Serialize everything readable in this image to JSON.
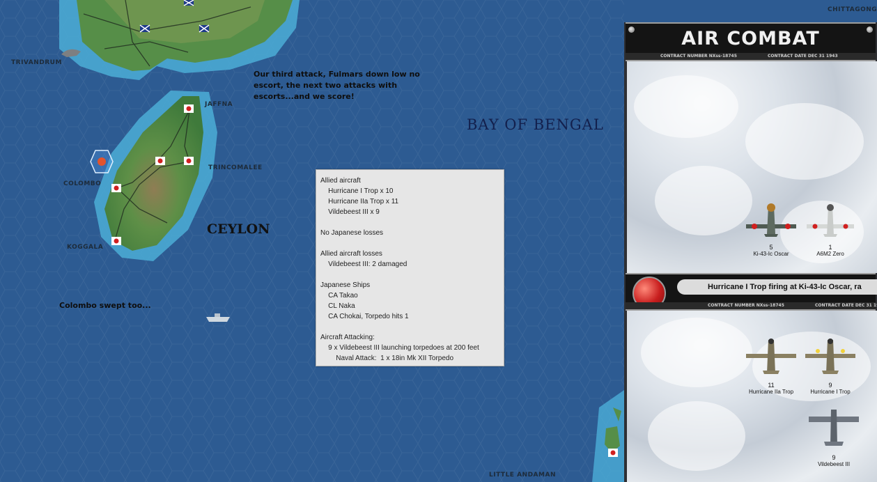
{
  "map": {
    "places": {
      "chittagong": "CHITTAGONG",
      "trivandrum": "TRIVANDRUM",
      "jaffna": "JAFFNA",
      "trincomalee": "TRINCOMALEE",
      "colombo": "COLOMBO",
      "koggala": "KOGGALA",
      "little_andaman": "LITTLE ANDAMAN"
    },
    "regions": {
      "ceylon": "CEYLON",
      "bay_of_bengal": "BAY OF BENGAL"
    },
    "notes": {
      "third_attack": [
        "Our third attack, Fulmars down low no",
        "escort, the next two attacks with",
        "escorts...and we score!"
      ],
      "colombo_swept": "Colombo swept too..."
    },
    "colors": {
      "sea": "#2d5b92",
      "shallow": "#4fb2d6",
      "land": "#4f8a45",
      "coast": "#7aa85c"
    }
  },
  "report": {
    "lines": [
      "Allied aircraft",
      "    Hurricane I Trop x 10",
      "    Hurricane IIa Trop x 11",
      "    Vildebeest III x 9",
      "",
      "No Japanese losses",
      "",
      "Allied aircraft losses",
      "    Vildebeest III: 2 damaged",
      "",
      "Japanese Ships",
      "    CA Takao",
      "    CL Naka",
      "    CA Chokai, Torpedo hits 1",
      "",
      "Aircraft Attacking:",
      "    9 x Vildebeest III launching torpedoes at 200 feet",
      "        Naval Attack:  1 x 18in Mk XII Torpedo"
    ]
  },
  "panel": {
    "title": "AIR COMBAT",
    "contract_number": "CONTRACT NUMBER  NXss-18745",
    "contract_date": "CONTRACT DATE  DEC 31 1943",
    "message": "Hurricane I Trop firing at Ki-43-Ic Oscar, ra",
    "enemy_aircraft": [
      {
        "count": "5",
        "name": "Ki-43-Ic Oscar"
      },
      {
        "count": "1",
        "name": "A6M2 Zero"
      }
    ],
    "allied_aircraft": [
      {
        "count": "11",
        "name": "Hurricane IIa Trop"
      },
      {
        "count": "9",
        "name": "Hurricane I Trop"
      },
      {
        "count": "9",
        "name": "Vildebeest III"
      }
    ]
  }
}
